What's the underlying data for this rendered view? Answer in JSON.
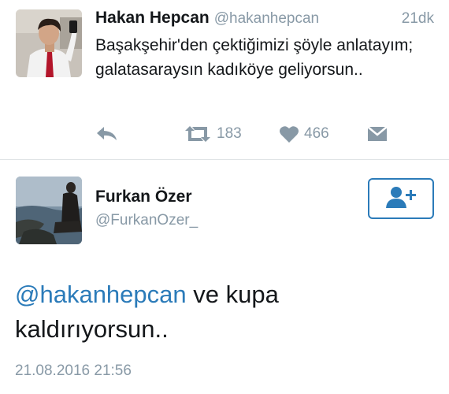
{
  "tweet1": {
    "author_name": "Hakan Hepcan",
    "author_handle": "@hakanhepcan",
    "time_ago": "21dk",
    "text": "Başakşehir'den çektiğimizi şöyle anlatayım; galatasaraysın kadıköye geliyorsun..",
    "retweet_count": "183",
    "like_count": "466",
    "icons": {
      "reply": "reply-icon",
      "retweet": "retweet-icon",
      "like": "heart-icon",
      "message": "envelope-icon"
    }
  },
  "tweet2": {
    "author_name": "Furkan Özer",
    "author_handle": "@FurkanOzer_",
    "mention": "@hakanhepcan",
    "text_rest": " ve kupa kaldırıyorsun..",
    "date": "21.08.2016 21:56",
    "follow_icon": "add-user-icon"
  },
  "colors": {
    "link_blue": "#2b7bb9",
    "muted_gray": "#8899a6",
    "text_dark": "#14171a",
    "divider": "#dfe3e6"
  }
}
